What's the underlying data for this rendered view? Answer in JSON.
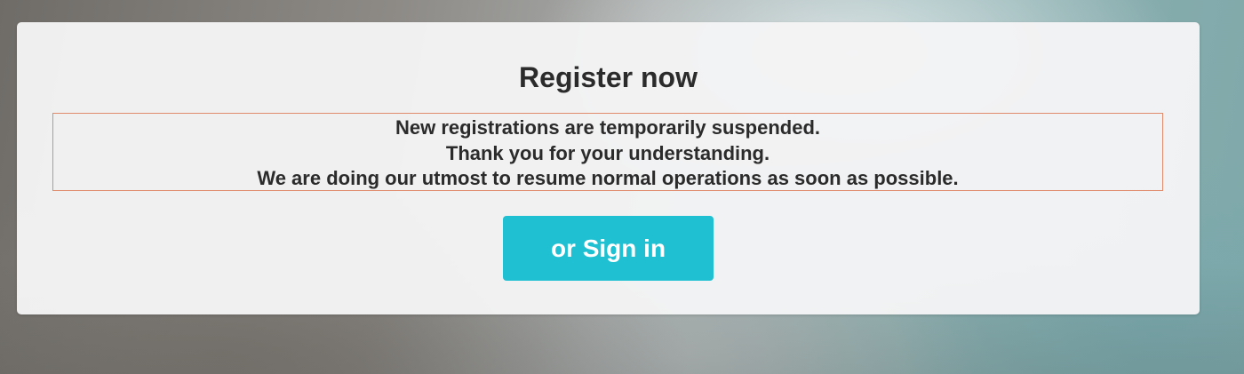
{
  "register": {
    "title": "Register now",
    "notice_lines": [
      "New registrations are temporarily suspended.",
      "Thank you for your understanding.",
      "We are doing our utmost to resume normal operations as soon as possible."
    ],
    "signin_label": "or Sign in"
  },
  "colors": {
    "button_bg": "#1fc0d1",
    "notice_border": "#e08c6c",
    "text": "#2b2b2b"
  }
}
